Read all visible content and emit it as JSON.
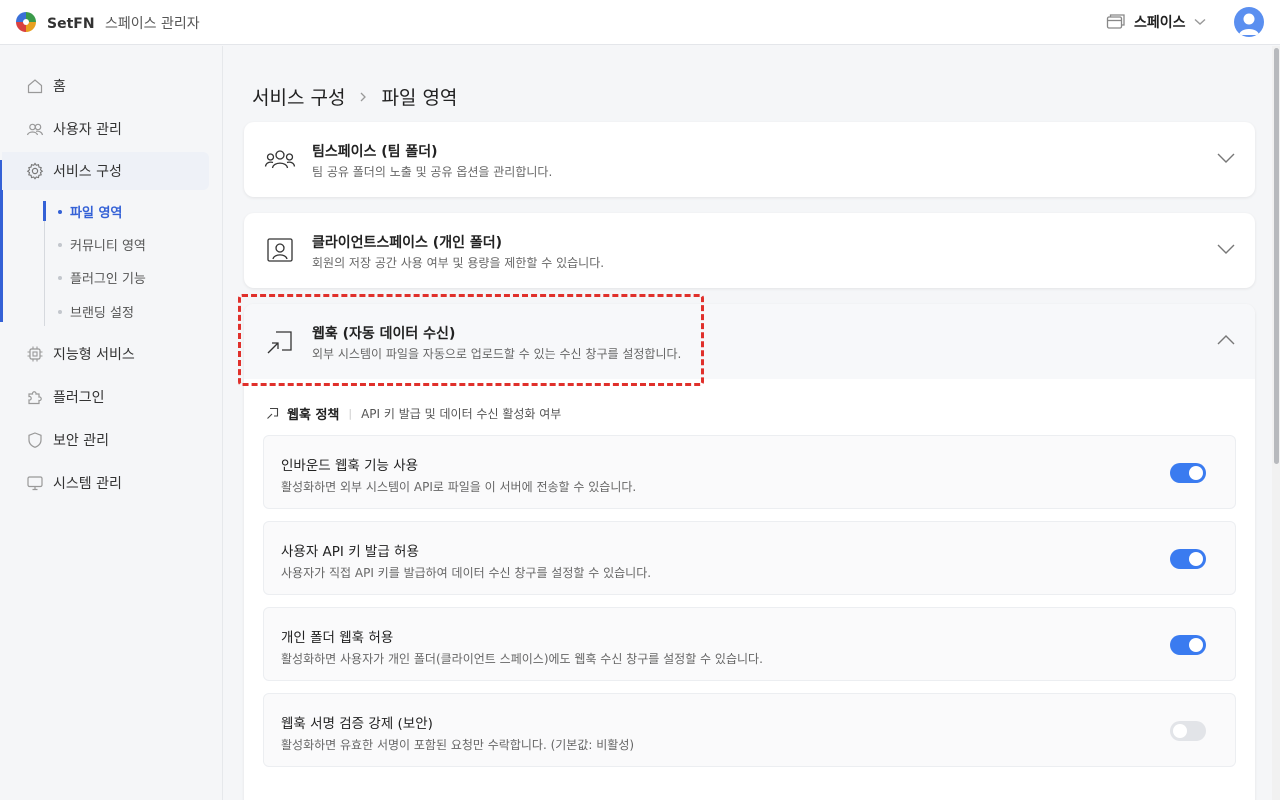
{
  "header": {
    "brand_name": "SetFN",
    "brand_sub": "스페이스 관리자",
    "space_label": "스페이스"
  },
  "sidebar": {
    "items": [
      {
        "label": "홈",
        "icon": "home-icon"
      },
      {
        "label": "사용자 관리",
        "icon": "users-icon"
      },
      {
        "label": "서비스 구성",
        "icon": "gear-icon"
      },
      {
        "label": "지능형 서비스",
        "icon": "chip-icon"
      },
      {
        "label": "플러그인",
        "icon": "puzzle-icon"
      },
      {
        "label": "보안 관리",
        "icon": "shield-icon"
      },
      {
        "label": "시스템 관리",
        "icon": "monitor-icon"
      }
    ],
    "sub_items": [
      {
        "label": "파일 영역"
      },
      {
        "label": "커뮤니티 영역"
      },
      {
        "label": "플러그인 기능"
      },
      {
        "label": "브랜딩 설정"
      }
    ]
  },
  "breadcrumb": {
    "parent": "서비스 구성",
    "current": "파일 영역"
  },
  "cards": [
    {
      "title": "팀스페이스 (팀 폴더)",
      "desc": "팀 공유 폴더의 노출 및 공유 옵션을 관리합니다."
    },
    {
      "title": "클라이언트스페이스 (개인 폴더)",
      "desc": "회원의 저장 공간 사용 여부 및 용량을 제한할 수 있습니다."
    },
    {
      "title": "웹훅 (자동 데이터 수신)",
      "desc": "외부 시스템이 파일을 자동으로 업로드할 수 있는 수신 창구를 설정합니다."
    }
  ],
  "policy": {
    "label": "웹훅 정책",
    "desc": "API 키 발급 및 데이터 수신 활성화 여부"
  },
  "settings": [
    {
      "title": "인바운드 웹훅 기능 사용",
      "desc": "활성화하면 외부 시스템이 API로 파일을 이 서버에 전송할 수 있습니다.",
      "enabled": true
    },
    {
      "title": "사용자 API 키 발급 허용",
      "desc": "사용자가 직접 API 키를 발급하여 데이터 수신 창구를 설정할 수 있습니다.",
      "enabled": true
    },
    {
      "title": "개인 폴더 웹훅 허용",
      "desc": "활성화하면 사용자가 개인 폴더(클라이언트 스페이스)에도 웹훅 수신 창구를 설정할 수 있습니다.",
      "enabled": true
    },
    {
      "title": "웹훅 서명 검증 강제 (보안)",
      "desc": "활성화하면 유효한 서명이 포함된 요청만 수락합니다. (기본값: 비활성)",
      "enabled": false
    }
  ],
  "colors": {
    "accent": "#3461d6",
    "toggle_on": "#3a7bf0",
    "highlight_dash": "#e0302b"
  }
}
